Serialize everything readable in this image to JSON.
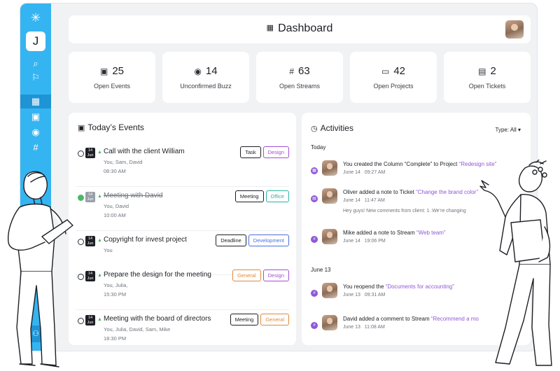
{
  "header": {
    "title": "Dashboard"
  },
  "sidebar": {
    "logo_icon": "asterisk-logo-icon",
    "workspace_initial": "J",
    "items": [
      {
        "icon": "search-icon",
        "glyph": "⌕"
      },
      {
        "icon": "bookmark-icon",
        "glyph": "⚐"
      },
      {
        "icon": "dashboard-grid-icon",
        "glyph": "▦",
        "active": true
      },
      {
        "icon": "calendar-icon",
        "glyph": "▣"
      },
      {
        "icon": "rss-icon",
        "glyph": "◉"
      },
      {
        "icon": "hash-icon",
        "glyph": "#"
      }
    ]
  },
  "stats": [
    {
      "value": "25",
      "label": "Open Events",
      "icon": "calendar-icon"
    },
    {
      "value": "14",
      "label": "Unconfirmed Buzz",
      "icon": "rss-icon"
    },
    {
      "value": "63",
      "label": "Open Streams",
      "icon": "hash-icon"
    },
    {
      "value": "42",
      "label": "Open Projects",
      "icon": "folder-icon"
    },
    {
      "value": "2",
      "label": "Open Tickets",
      "icon": "ticket-icon"
    }
  ],
  "events": {
    "title": "Today’s Events",
    "items": [
      {
        "day": "14",
        "month": "Jun",
        "title": "Call with the client William",
        "people": "You, Sam, David",
        "time": "08:30 AM",
        "done": false,
        "tags": [
          {
            "label": "Task",
            "color": "#1d1f24"
          },
          {
            "label": "Design",
            "color": "#a14fd6"
          }
        ]
      },
      {
        "day": "14",
        "month": "Jun",
        "title": "Meeting with David",
        "people": "You, David",
        "time": "10:00 AM",
        "done": true,
        "tags": [
          {
            "label": "Meeting",
            "color": "#1d1f24"
          },
          {
            "label": "Office",
            "color": "#2ab3a0"
          }
        ]
      },
      {
        "day": "14",
        "month": "Jun",
        "title": "Copyright for invest project",
        "people": "You",
        "time": "",
        "done": false,
        "tags": [
          {
            "label": "Deadline",
            "color": "#1d1f24"
          },
          {
            "label": "Development",
            "color": "#4a6fe0"
          }
        ]
      },
      {
        "day": "14",
        "month": "Jun",
        "title": "Prepare the design for the meeting",
        "people": "You, Julia,",
        "time": "15:30 PM",
        "done": false,
        "tags": [
          {
            "label": "General",
            "color": "#e08a3c"
          },
          {
            "label": "Design",
            "color": "#a14fd6"
          }
        ]
      },
      {
        "day": "14",
        "month": "Jun",
        "title": "Meeting with the board of directors",
        "people": "You, Julia, David, Sam, Mike",
        "time": "18:30 PM",
        "done": false,
        "tags": [
          {
            "label": "Meeting",
            "color": "#1d1f24"
          },
          {
            "label": "General",
            "color": "#e08a3c"
          }
        ]
      }
    ]
  },
  "activities": {
    "title": "Activities",
    "type_filter": "Type: All ▾",
    "groups": [
      {
        "day": "Today",
        "items": [
          {
            "text": "You created the Column “Complete” to Project ",
            "link": "“Redesign site”",
            "date": "June 14",
            "time": "09:27 AM",
            "note": ""
          },
          {
            "text": "Oliver added a note to Ticket ",
            "link": "“Change the brand color”",
            "date": "June 14",
            "time": "11:47 AM",
            "note": "Hey guys! New comments from client: 1. We’re changing"
          },
          {
            "text": "Mike added a note to Stream ",
            "link": "“Web team”",
            "date": "June 14",
            "time": "19:06 PM",
            "note": ""
          }
        ]
      },
      {
        "day": "June 13",
        "items": [
          {
            "text": "You reopend the ",
            "link": "“Documents for accounting”",
            "date": "June 13",
            "time": "09:31 AM",
            "note": ""
          },
          {
            "text": "David added a comment to Stream ",
            "link": "“Recommend a mo",
            "date": "June 13",
            "time": "11:08 AM",
            "note": ""
          }
        ]
      }
    ]
  }
}
